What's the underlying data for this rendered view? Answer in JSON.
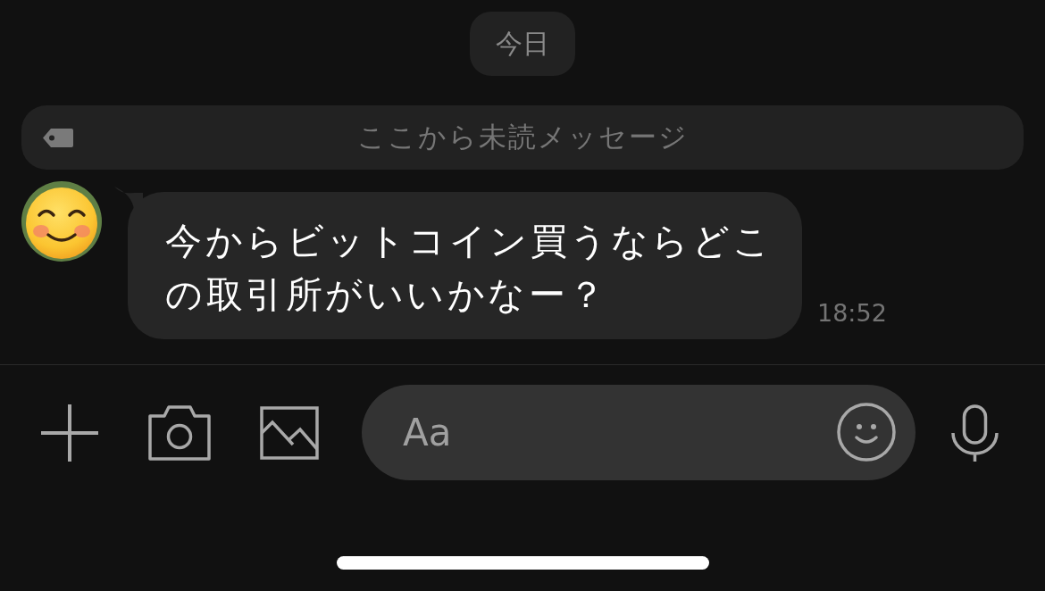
{
  "date_badge": {
    "label": "今日"
  },
  "unread_divider": {
    "label": "ここから未読メッセージ"
  },
  "messages": [
    {
      "kind": "incoming",
      "text": "今からビットコイン買うならどこの取引所がいいかなー？",
      "time": "18:52"
    }
  ],
  "composer": {
    "placeholder": "Aa"
  }
}
